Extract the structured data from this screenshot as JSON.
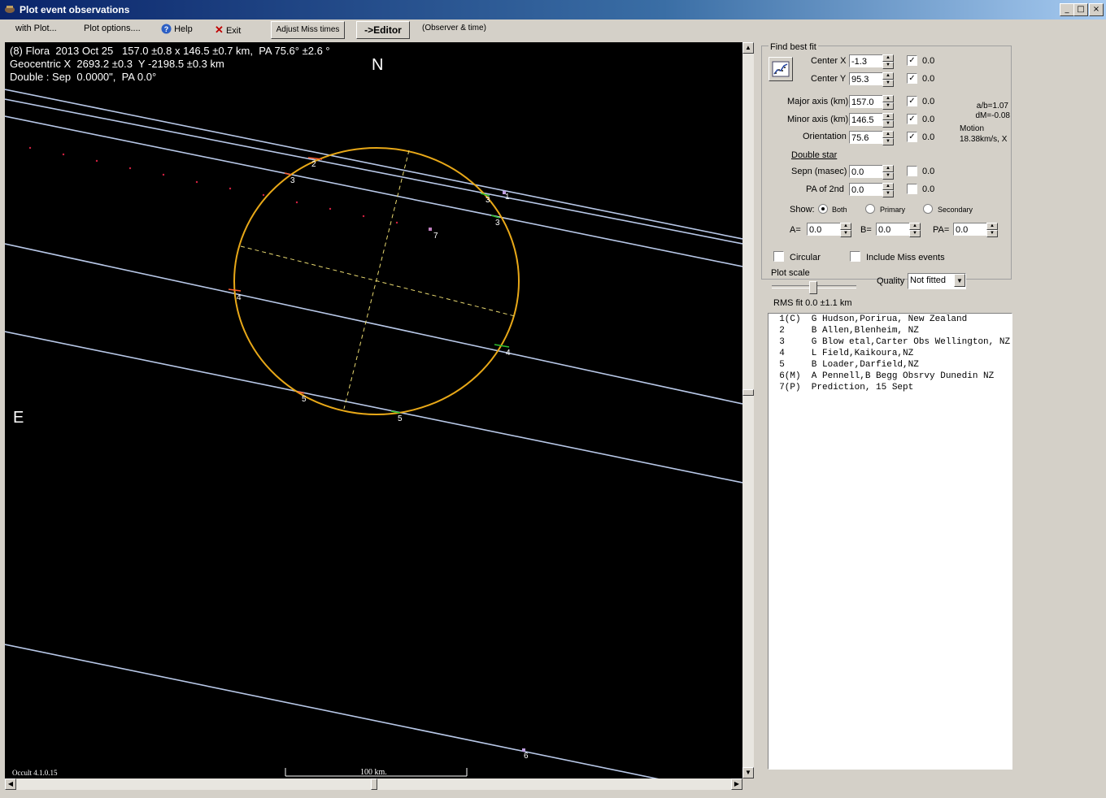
{
  "window": {
    "title": "Plot event observations"
  },
  "menu": {
    "with_plot": "with Plot...",
    "plot_options": "Plot options....",
    "help": "Help",
    "exit": "Exit",
    "adjust_miss_times": "Adjust Miss times",
    "editor": "->Editor",
    "observer_time": "(Observer & time)"
  },
  "plot": {
    "header_line1": "(8) Flora  2013 Oct 25   157.0 ±0.8 x 146.5 ±0.7 km,  PA 75.6° ±2.6 °",
    "header_line2": "Geocentric X  2693.2 ±0.3  Y -2198.5 ±0.3 km",
    "header_line3": "Double : Sep  0.0000\",  PA 0.0°",
    "north": "N",
    "east": "E",
    "version": "Occult 4.1.0.15",
    "scale_label": "100 km.",
    "event_labels": [
      "1",
      "2",
      "3",
      "3",
      "3",
      "4",
      "4",
      "5",
      "5",
      "6",
      "7"
    ]
  },
  "panel": {
    "find_best_fit": "Find best fit",
    "center_x_label": "Center X",
    "center_x": "-1.3",
    "center_y_label": "Center Y",
    "center_y": "95.3",
    "major_axis_label": "Major axis (km)",
    "major_axis": "157.0",
    "minor_axis_label": "Minor axis (km)",
    "minor_axis": "146.5",
    "orientation_label": "Orientation",
    "orientation": "75.6",
    "uncert": "0.0",
    "ab_ratio": "a/b=1.07",
    "dm": "dM=-0.08",
    "motion_label": "Motion",
    "motion_value": "18.38km/s, X",
    "double_star": "Double star",
    "sepn_label": "Sepn (masec)",
    "sepn": "0.0",
    "pa2_label": "PA of 2nd",
    "pa2": "0.0",
    "show_label": "Show:",
    "show_options": [
      "Both",
      "Primary",
      "Secondary"
    ],
    "a_label": "A=",
    "a_value": "0.0",
    "b_label": "B=",
    "b_value": "0.0",
    "pa_label": "PA=",
    "pa_value": "0.0",
    "circular": "Circular",
    "include_miss": "Include Miss events",
    "plot_scale": "Plot scale",
    "quality_label": "Quality",
    "quality_value": "Not fitted",
    "rms_fit": "RMS fit 0.0 ±1.1 km",
    "observers": [
      "  1(C)  G Hudson,Porirua, New Zealand",
      "  2     B Allen,Blenheim, NZ",
      "  3     G Blow etal,Carter Obs Wellington, NZ",
      "  4     L Field,Kaikoura,NZ",
      "  5     B Loader,Darfield,NZ",
      "  6(M)  A Pennell,B Begg Obsrvy Dunedin NZ",
      "  7(P)  Prediction, 15 Sept"
    ]
  }
}
